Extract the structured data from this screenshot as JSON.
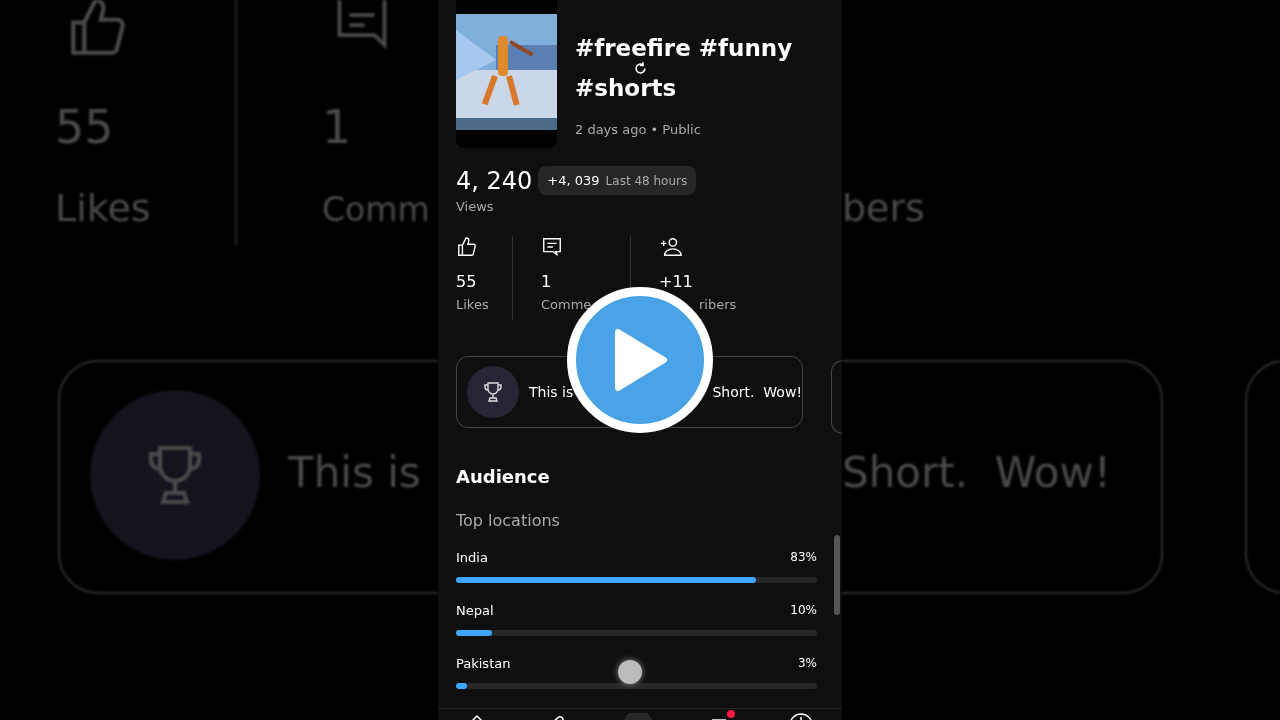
{
  "backdrop": {
    "left": {
      "likes_count": "55",
      "likes_label": "Likes",
      "comments_count": "1",
      "comments_label": "Comm",
      "card_text": "This is"
    },
    "right": {
      "subscribers_label": "bers",
      "card_text": "Short.  Wow!"
    }
  },
  "video": {
    "thumbnail": {
      "kind": "picture"
    },
    "title_lines": [
      "#freefire #funny",
      "#shorts"
    ],
    "meta": "2 days ago • Public"
  },
  "views": {
    "count": "4, 240",
    "delta": "+4, 039",
    "delta_period": "Last 48 hours",
    "label": "Views"
  },
  "stats": [
    {
      "kind": "likes",
      "count": "55",
      "label": "Likes"
    },
    {
      "kind": "comments",
      "count": "1",
      "label": "Comme"
    },
    {
      "kind": "subscribers",
      "count": "+11",
      "label": "ribers"
    }
  ],
  "milestone": {
    "text_start": "This is",
    "text_end": "Short.  Wow!"
  },
  "audience": {
    "title": "Audience",
    "subtitle": "Top locations",
    "locations": [
      {
        "name": "India",
        "percent": "83%",
        "level": 0.83
      },
      {
        "name": "Nepal",
        "percent": "10%",
        "level": 0.1
      },
      {
        "name": "Pakistan",
        "percent": "3%",
        "level": 0.03
      }
    ]
  },
  "nav": {
    "notifications_dot": true
  }
}
